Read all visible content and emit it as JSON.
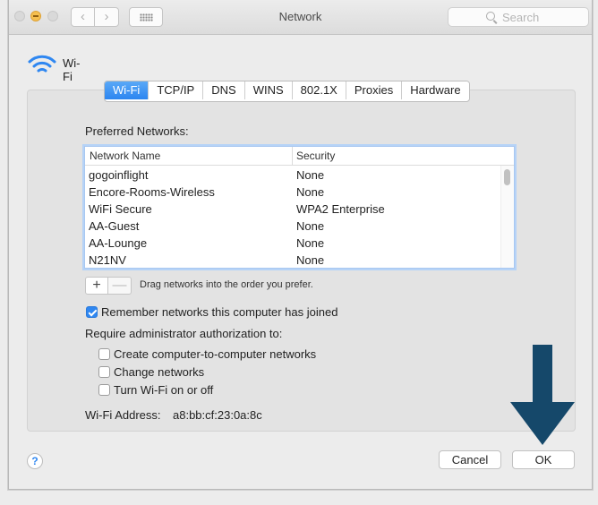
{
  "window": {
    "title": "Network",
    "search_placeholder": "Search"
  },
  "toolbar": {
    "back_glyph": "‹",
    "forward_glyph": "›"
  },
  "interface": {
    "name": "Wi-Fi",
    "icon": "wifi-icon",
    "accent": "#2f87f1"
  },
  "tabs": [
    {
      "label": "Wi-Fi",
      "active": true
    },
    {
      "label": "TCP/IP",
      "active": false
    },
    {
      "label": "DNS",
      "active": false
    },
    {
      "label": "WINS",
      "active": false
    },
    {
      "label": "802.1X",
      "active": false
    },
    {
      "label": "Proxies",
      "active": false
    },
    {
      "label": "Hardware",
      "active": false
    }
  ],
  "preferred": {
    "label": "Preferred Networks:",
    "columns": [
      "Network Name",
      "Security"
    ],
    "rows": [
      {
        "name": "gogoinflight",
        "security": "None"
      },
      {
        "name": "Encore-Rooms-Wireless",
        "security": "None"
      },
      {
        "name": "WiFi Secure",
        "security": "WPA2 Enterprise"
      },
      {
        "name": "AA-Guest",
        "security": "None"
      },
      {
        "name": "AA-Lounge",
        "security": "None"
      },
      {
        "name": "N21NV",
        "security": "None"
      }
    ],
    "add_glyph": "+",
    "remove_glyph": "—",
    "hint": "Drag networks into the order you prefer."
  },
  "options": {
    "remember": {
      "label": "Remember networks this computer has joined",
      "checked": true
    },
    "admin_heading": "Require administrator authorization to:",
    "admin_items": [
      {
        "label": "Create computer-to-computer networks",
        "checked": false
      },
      {
        "label": "Change networks",
        "checked": false
      },
      {
        "label": "Turn Wi-Fi on or off",
        "checked": false
      }
    ]
  },
  "address": {
    "label": "Wi-Fi Address:",
    "value": "a8:bb:cf:23:0a:8c"
  },
  "footer": {
    "help_glyph": "?",
    "cancel_label": "Cancel",
    "ok_label": "OK"
  },
  "annotation": {
    "arrow_icon": "down-arrow-icon",
    "color": "#15486a"
  }
}
